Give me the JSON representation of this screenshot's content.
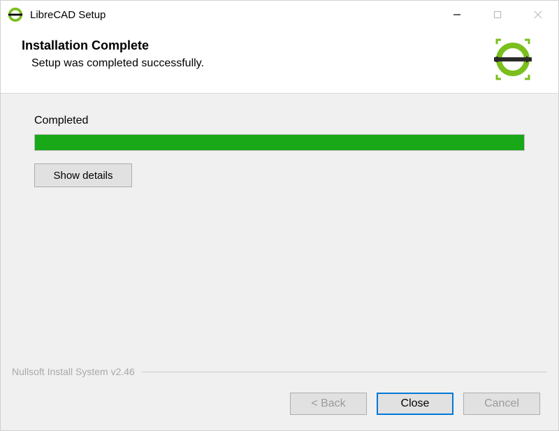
{
  "titlebar": {
    "title": "LibreCAD Setup"
  },
  "header": {
    "title": "Installation Complete",
    "subtitle": "Setup was completed successfully."
  },
  "content": {
    "status": "Completed",
    "progress_percent": 100,
    "show_details": "Show details"
  },
  "footer": {
    "brand": "Nullsoft Install System v2.46",
    "back": "< Back",
    "close": "Close",
    "cancel": "Cancel"
  },
  "colors": {
    "progress_fill": "#18a818",
    "accent": "#7bbf1e"
  }
}
